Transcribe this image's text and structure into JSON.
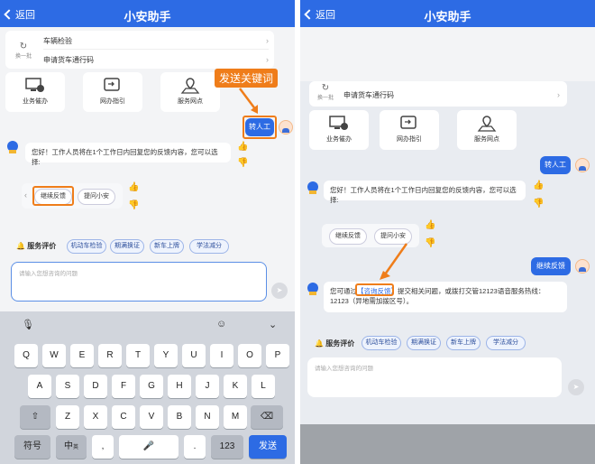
{
  "left": {
    "nav": {
      "back": "返回",
      "title": "小安助手"
    },
    "list": [
      "车辆检验",
      "申请货车通行码"
    ],
    "refresh": "换一批",
    "services": [
      "业务催办",
      "网办指引",
      "服务网点"
    ],
    "annotation": "发送关键词",
    "user_msg": "转人工",
    "bot_msg": "您好！工作人员将在1个工作日内回复您的反馈内容，您可以选择:",
    "chips": [
      "继续反馈",
      "提问小安"
    ],
    "rating": "服务评价",
    "tags": [
      "机动车检验",
      "期满换证",
      "新车上牌",
      "学法减分"
    ],
    "input_placeholder": "请输入您想咨询的问题",
    "keyboard": {
      "row1": [
        "Q",
        "W",
        "E",
        "R",
        "T",
        "Y",
        "U",
        "I",
        "O",
        "P"
      ],
      "row2": [
        "A",
        "S",
        "D",
        "F",
        "G",
        "H",
        "J",
        "K",
        "L"
      ],
      "row3": [
        "Z",
        "X",
        "C",
        "V",
        "B",
        "N",
        "M"
      ],
      "bottom": {
        "sym": "符号",
        "lang": "中",
        "lang_sub": "英",
        "comma": ",",
        "dot": ".",
        "num": "123",
        "send": "发送"
      }
    }
  },
  "right": {
    "nav": {
      "back": "返回",
      "title": "小安助手"
    },
    "refresh": "换一批",
    "list": [
      "申请货车通行码"
    ],
    "services": [
      "业务催办",
      "网办指引",
      "服务网点"
    ],
    "user_msg1": "转人工",
    "bot_msg1": "您好！工作人员将在1个工作日内回复您的反馈内容，您可以选择:",
    "chips": [
      "继续反馈",
      "提问小安"
    ],
    "user_msg2": "继续反馈",
    "bot_msg2_pre": "您可通过",
    "bot_msg2_link": "【咨询反馈】",
    "bot_msg2_post": "提交相关问题，或拨打交管12123语音服务热线：12123（异地需加拨区号）。",
    "rating": "服务评价",
    "tags": [
      "机动车检验",
      "期满换证",
      "新车上牌",
      "学法减分"
    ],
    "input_placeholder": "请输入您想咨询的问题"
  },
  "colors": {
    "brand_blue": "#2d6be4",
    "annotation_orange": "#ef7d1a"
  }
}
